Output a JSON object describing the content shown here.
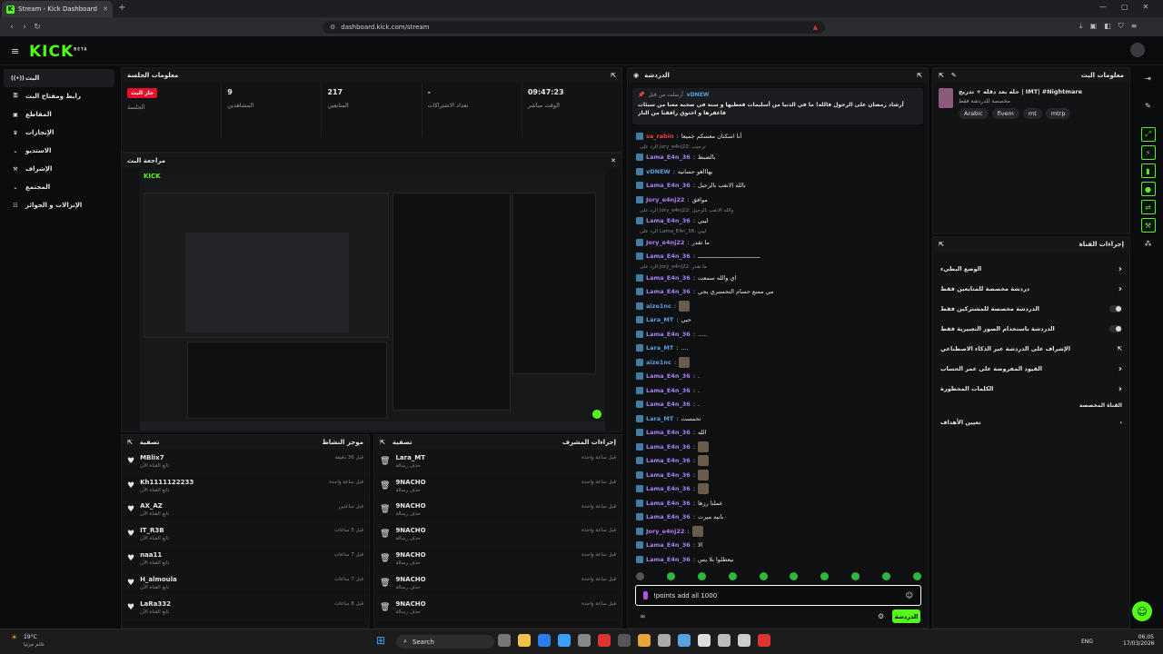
{
  "browser": {
    "tab_title": "Stream - Kick Dashboard",
    "url": "dashboard.kick.com/stream",
    "new_tab": "+"
  },
  "app": {
    "logo": "KICK",
    "logo_sup": "BETA"
  },
  "nav": {
    "items": [
      {
        "label": "البث",
        "icon": "live-icon"
      },
      {
        "label": "رابط ومفتاح البث",
        "icon": "key-icon"
      },
      {
        "label": "المقاطع",
        "icon": "clips-icon"
      },
      {
        "label": "الإنجازات",
        "icon": "achievements-icon"
      },
      {
        "label": "الاستديو",
        "icon": "studio-icon"
      },
      {
        "label": "الإشراف",
        "icon": "moderation-icon"
      },
      {
        "label": "المجتمع",
        "icon": "community-icon"
      },
      {
        "label": "الإنزالات و الجوائز",
        "icon": "drops-icon"
      }
    ]
  },
  "session": {
    "title": "معلومات الجلسة",
    "live_badge": "جار البث",
    "live_label": "الجلسة",
    "stats": [
      {
        "value": "9",
        "label": "المشاهدين"
      },
      {
        "value": "217",
        "label": "المتابعين"
      },
      {
        "value": "-",
        "label": "تعداد الاشتراكات"
      },
      {
        "value": "09:47:23",
        "label": "الوقت مباشر"
      }
    ]
  },
  "preview": {
    "title": "مراجعة البث"
  },
  "activity": {
    "title": "موجز النشاط",
    "filter": "تصفية",
    "items": [
      {
        "name": "MBlix7",
        "sub": "تابع القناة الآن",
        "time": "قبل 36 دقيقة"
      },
      {
        "name": "Kh1111122233",
        "sub": "تابع القناة الآن",
        "time": "قبل ساعة واحدة"
      },
      {
        "name": "AX_AZ",
        "sub": "تابع القناة الآن",
        "time": "قبل ساعتين"
      },
      {
        "name": "IT_R3B",
        "sub": "تابع القناة الآن",
        "time": "قبل 5 ساعات"
      },
      {
        "name": "naa11",
        "sub": "تابع القناة الآن",
        "time": "قبل 7 ساعات"
      },
      {
        "name": "H_almoula",
        "sub": "تابع القناة الآن",
        "time": "قبل 7 ساعات"
      },
      {
        "name": "LaRa332",
        "sub": "تابع القناة الآن",
        "time": "قبل 8 ساعات"
      }
    ]
  },
  "modlog": {
    "title": "إجراءات المشرف",
    "filter": "تصفية",
    "items": [
      {
        "name": "Lara_MT",
        "sub": "حذف رسالة",
        "time": "قبل ساعة واحدة"
      },
      {
        "name": "9NACHO",
        "sub": "حذف رسالة",
        "time": "قبل ساعة واحدة"
      },
      {
        "name": "9NACHO",
        "sub": "حذف رسالة",
        "time": "قبل ساعة واحدة"
      },
      {
        "name": "9NACHO",
        "sub": "حذف رسالة",
        "time": "قبل ساعة واحدة"
      },
      {
        "name": "9NACHO",
        "sub": "حذف رسالة",
        "time": "قبل ساعة واحدة"
      },
      {
        "name": "9NACHO",
        "sub": "حذف رسالة",
        "time": "قبل ساعة واحدة"
      },
      {
        "name": "9NACHO",
        "sub": "حذف رسالة",
        "time": "قبل ساعة واحدة"
      }
    ]
  },
  "chat": {
    "title": "الدردشة",
    "pinned": {
      "by_label": "أرسلت من قبل",
      "by_user": "vDNEW",
      "text": "أرشاد رمضان على الرحول فالله! ما في الدنيا من أسليمات فعطيها و سنة في صحبه معنا من سيئات فاغفرها و احتوق رافقنا من النار"
    },
    "messages": [
      {
        "user": "sa_rabin",
        "cls": "u4",
        "text": "أنا اسكنان معسكم جميعا"
      },
      {
        "user": "Lama_E4n_36",
        "cls": "u1",
        "text": "بالضبط",
        "reply": "الرد على Jory_e4nj22: ترحيب"
      },
      {
        "user": "vDNEW",
        "cls": "u2",
        "text": "يهاااهو حسانيه"
      },
      {
        "user": "Lama_E4n_36",
        "cls": "u1",
        "text": "بالله الانعب بالرحيل"
      },
      {
        "user": "Jory_e4nj22",
        "cls": "u3",
        "text": "موافق"
      },
      {
        "user": "Lama_E4n_36",
        "cls": "u1",
        "text": "ليبي",
        "reply": "الرد على Jory_e4nj22: والله الانعب بالرحيل"
      },
      {
        "user": "Jory_e4nj22",
        "cls": "u3",
        "text": "ما تقدر",
        "reply": "الرد على Lama_E4n_36: ليبي"
      },
      {
        "user": "Lama_E4n_36",
        "cls": "u1",
        "text": "ــــــــــــــــــــــــــــــــــــ"
      },
      {
        "user": "Lama_E4n_36",
        "cls": "u1",
        "text": "اي والله سمعت",
        "reply": "الرد على Jory_e4nj22: ما تقدر"
      },
      {
        "user": "Lama_E4n_36",
        "cls": "u1",
        "text": "مي ممنع حسام التحسنري يجي"
      },
      {
        "user": "aize1nc",
        "cls": "u2",
        "text": ""
      },
      {
        "user": "Lara_MT",
        "cls": "u2",
        "text": "حبي"
      },
      {
        "user": "Lama_E4n_36",
        "cls": "u1",
        "text": "....."
      },
      {
        "user": "Lara_MT",
        "cls": "u2",
        "text": "...."
      },
      {
        "user": "aize1nc",
        "cls": "u2",
        "text": ""
      },
      {
        "user": "Lama_E4n_36",
        "cls": "u1",
        "text": "."
      },
      {
        "user": "Lama_E4n_36",
        "cls": "u1",
        "text": "."
      },
      {
        "user": "Lama_E4n_36",
        "cls": "u1",
        "text": "."
      },
      {
        "user": "Lara_MT",
        "cls": "u2",
        "text": "تحمست"
      },
      {
        "user": "Lama_E4n_36",
        "cls": "u1",
        "text": "الله"
      },
      {
        "user": "Lama_E4n_36",
        "cls": "u1",
        "text": ""
      },
      {
        "user": "Lama_E4n_36",
        "cls": "u1",
        "text": ""
      },
      {
        "user": "Lama_E4n_36",
        "cls": "u1",
        "text": ""
      },
      {
        "user": "Lama_E4n_36",
        "cls": "u1",
        "text": ""
      },
      {
        "user": "Lama_E4n_36",
        "cls": "u1",
        "text": "عملنا رزها"
      },
      {
        "user": "Lama_E4n_36",
        "cls": "u1",
        "text": "بانيه ميرت"
      },
      {
        "user": "Jory_e4nj22",
        "cls": "u3",
        "text": ""
      },
      {
        "user": "Lama_E4n_36",
        "cls": "u1",
        "text": "الا"
      },
      {
        "user": "Lama_E4n_36",
        "cls": "u1",
        "text": "نيعطلوا بلا يس"
      }
    ],
    "input_value": "!points add all 1000",
    "send_label": "الدردشة"
  },
  "stream_info": {
    "title": "معلومات البث",
    "stream_title": "حله بعد دقله + تدريج | IMT| #Nightmare",
    "category": "مخصصة للدردشة فقط",
    "tags": [
      "Arabic",
      "fivem",
      "mt",
      "mtrp"
    ]
  },
  "channel_actions": {
    "title": "إجراءات القناة",
    "items": [
      {
        "label": "الوضع البطيء",
        "type": "arrow"
      },
      {
        "label": "دردشة مخصصة للمتابعين فقط",
        "type": "arrow"
      },
      {
        "label": "الدردشة مخصصة للمشتركين فقط",
        "type": "toggle"
      },
      {
        "label": "الدردشة باستخدام الصور التعبيرية فقط",
        "type": "toggle"
      },
      {
        "label": "الإشراف على الدردشة عبر الذكاء الاصطناعي",
        "type": "ext"
      },
      {
        "label": "القيود المفروضة على عمر الحساب",
        "type": "arrow"
      },
      {
        "label": "الكلمات المحظورة",
        "type": "arrow"
      }
    ],
    "section": "القناة المخصصة",
    "target": "تعيين الأهداف"
  },
  "taskbar": {
    "weather_temp": "19°C",
    "weather_text": "غائم جزئيا",
    "search": "Search",
    "lang": "ENG",
    "time": "06:05",
    "date": "17/03/2026"
  }
}
